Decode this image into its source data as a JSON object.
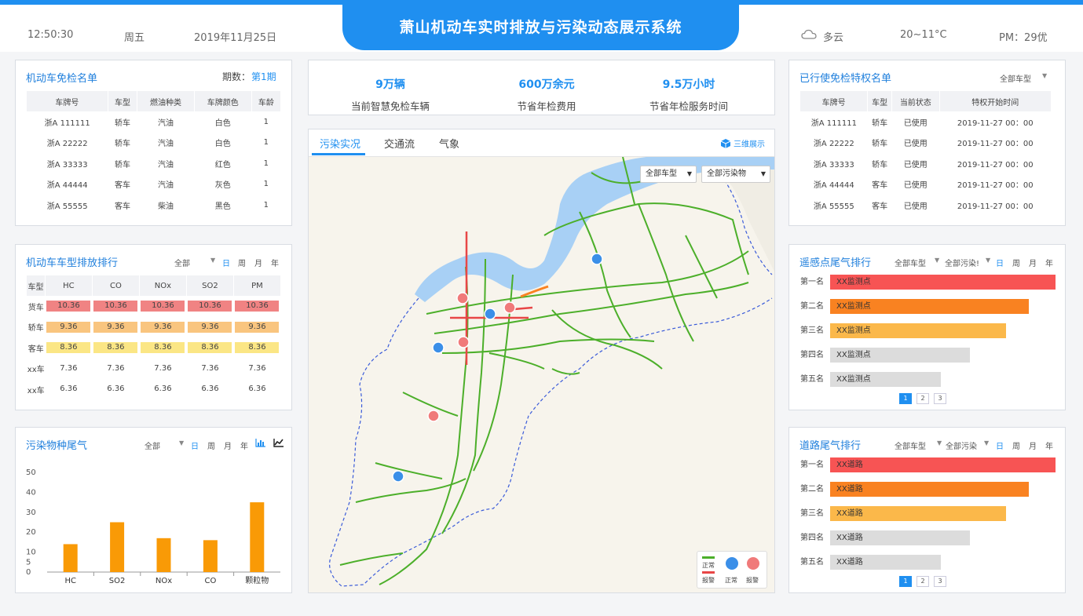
{
  "header": {
    "title": "萧山机动车实时排放与污染动态展示系统",
    "time": "12:50:30",
    "weekday": "周五",
    "date": "2019年11月25日",
    "weather": "多云",
    "temperature": "20~11°C",
    "pm": "PM：29优"
  },
  "exempt_list": {
    "title": "机动车免检名单",
    "period_label": "期数：",
    "period_value": "第1期",
    "columns": [
      "车牌号",
      "车型",
      "燃油种类",
      "车牌颜色",
      "车龄"
    ],
    "rows": [
      [
        "浙A 111111",
        "轿车",
        "汽油",
        "白色",
        "1"
      ],
      [
        "浙A 22222",
        "轿车",
        "汽油",
        "白色",
        "1"
      ],
      [
        "浙A 33333",
        "轿车",
        "汽油",
        "红色",
        "1"
      ],
      [
        "浙A 44444",
        "客车",
        "汽油",
        "灰色",
        "1"
      ],
      [
        "浙A 55555",
        "客车",
        "柴油",
        "黑色",
        "1"
      ]
    ]
  },
  "emission_rank": {
    "title": "机动车车型排放排行",
    "filter": "全部",
    "periods": [
      "日",
      "周",
      "月",
      "年"
    ],
    "columns": [
      "车型",
      "HC",
      "CO",
      "NOx",
      "SO2",
      "PM"
    ],
    "rows": [
      {
        "type": "货车",
        "values": [
          "10.36",
          "10.36",
          "10.36",
          "10.36",
          "10.36"
        ],
        "color": "#f08383"
      },
      {
        "type": "轿车",
        "values": [
          "9.36",
          "9.36",
          "9.36",
          "9.36",
          "9.36"
        ],
        "color": "#f9c57f"
      },
      {
        "type": "客车",
        "values": [
          "8.36",
          "8.36",
          "8.36",
          "8.36",
          "8.36"
        ],
        "color": "#fbe685"
      },
      {
        "type": "xx车",
        "values": [
          "7.36",
          "7.36",
          "7.36",
          "7.36",
          "7.36"
        ],
        "color": ""
      },
      {
        "type": "xx车",
        "values": [
          "6.36",
          "6.36",
          "6.36",
          "6.36",
          "6.36"
        ],
        "color": ""
      }
    ]
  },
  "pollutant_chart": {
    "title": "污染物种尾气",
    "filter": "全部",
    "periods": [
      "日",
      "周",
      "月",
      "年"
    ],
    "bar_color": "#f99a06"
  },
  "chart_data": {
    "type": "bar",
    "categories": [
      "HC",
      "SO2",
      "NOx",
      "CO",
      "颗粒物"
    ],
    "values": [
      14,
      25,
      17,
      16,
      35
    ],
    "yticks": [
      0,
      5,
      10,
      20,
      30,
      40,
      50
    ],
    "ylim": [
      0,
      50
    ],
    "title": "",
    "xlabel": "",
    "ylabel": "",
    "grid": false
  },
  "stats": [
    {
      "value": "9万辆",
      "label": "当前智慧免检车辆"
    },
    {
      "value": "600万余元",
      "label": "节省年检费用"
    },
    {
      "value": "9.5万小时",
      "label": "节省年检服务时间"
    }
  ],
  "map_panel": {
    "tabs": [
      "污染实况",
      "交通流",
      "气象"
    ],
    "view3d": "三维展示",
    "vehicle_select": "全部车型",
    "pollutant_select": "全部污染物",
    "legend_normal": "正常",
    "legend_alarm": "报警",
    "legend_normal2": "正常",
    "legend_alarm2": "报警",
    "river_color": "#a8d0f5",
    "road_color": "#4caf2a",
    "alarm_road_color": "#e84646"
  },
  "privilege_list": {
    "title": "已行使免检特权名单",
    "filter": "全部车型",
    "columns": [
      "车牌号",
      "车型",
      "当前状态",
      "特权开始时间"
    ],
    "rows": [
      [
        "浙A 111111",
        "轿车",
        "已使用",
        "2019-11-27 00：00"
      ],
      [
        "浙A 22222",
        "轿车",
        "已使用",
        "2019-11-27 00：00"
      ],
      [
        "浙A 33333",
        "轿车",
        "已使用",
        "2019-11-27 00：00"
      ],
      [
        "浙A 44444",
        "客车",
        "已使用",
        "2019-11-27 00：00"
      ],
      [
        "浙A 55555",
        "客车",
        "已使用",
        "2019-11-27 00：00"
      ]
    ]
  },
  "sensor_rank": {
    "title": "遥感点尾气排行",
    "filter1": "全部车型",
    "filter2": "全部污染!",
    "periods": [
      "日",
      "周",
      "月",
      "年"
    ],
    "items": [
      {
        "rank": "第一名",
        "name": "XX监测点",
        "value": 1.0,
        "color": "#f75454"
      },
      {
        "rank": "第二名",
        "name": "XX监测点",
        "value": 0.88,
        "color": "#f98221"
      },
      {
        "rank": "第三名",
        "name": "XX监测点",
        "value": 0.78,
        "color": "#fbb84a"
      },
      {
        "rank": "第四名",
        "name": "XX监测点",
        "value": 0.62,
        "color": "#dcdcdc"
      },
      {
        "rank": "第五名",
        "name": "XX监测点",
        "value": 0.49,
        "color": "#dcdcdc"
      }
    ],
    "pages": [
      "1",
      "2",
      "3"
    ]
  },
  "road_rank": {
    "title": "道路尾气排行",
    "filter1": "全部车型",
    "filter2": "全部污染",
    "periods": [
      "日",
      "周",
      "月",
      "年"
    ],
    "items": [
      {
        "rank": "第一名",
        "name": "XX道路",
        "value": 1.0,
        "color": "#f75454"
      },
      {
        "rank": "第二名",
        "name": "XX道路",
        "value": 0.88,
        "color": "#f98221"
      },
      {
        "rank": "第三名",
        "name": "XX道路",
        "value": 0.78,
        "color": "#fbb84a"
      },
      {
        "rank": "第四名",
        "name": "XX道路",
        "value": 0.62,
        "color": "#dcdcdc"
      },
      {
        "rank": "第五名",
        "name": "XX道路",
        "value": 0.49,
        "color": "#dcdcdc"
      }
    ],
    "pages": [
      "1",
      "2",
      "3"
    ]
  }
}
